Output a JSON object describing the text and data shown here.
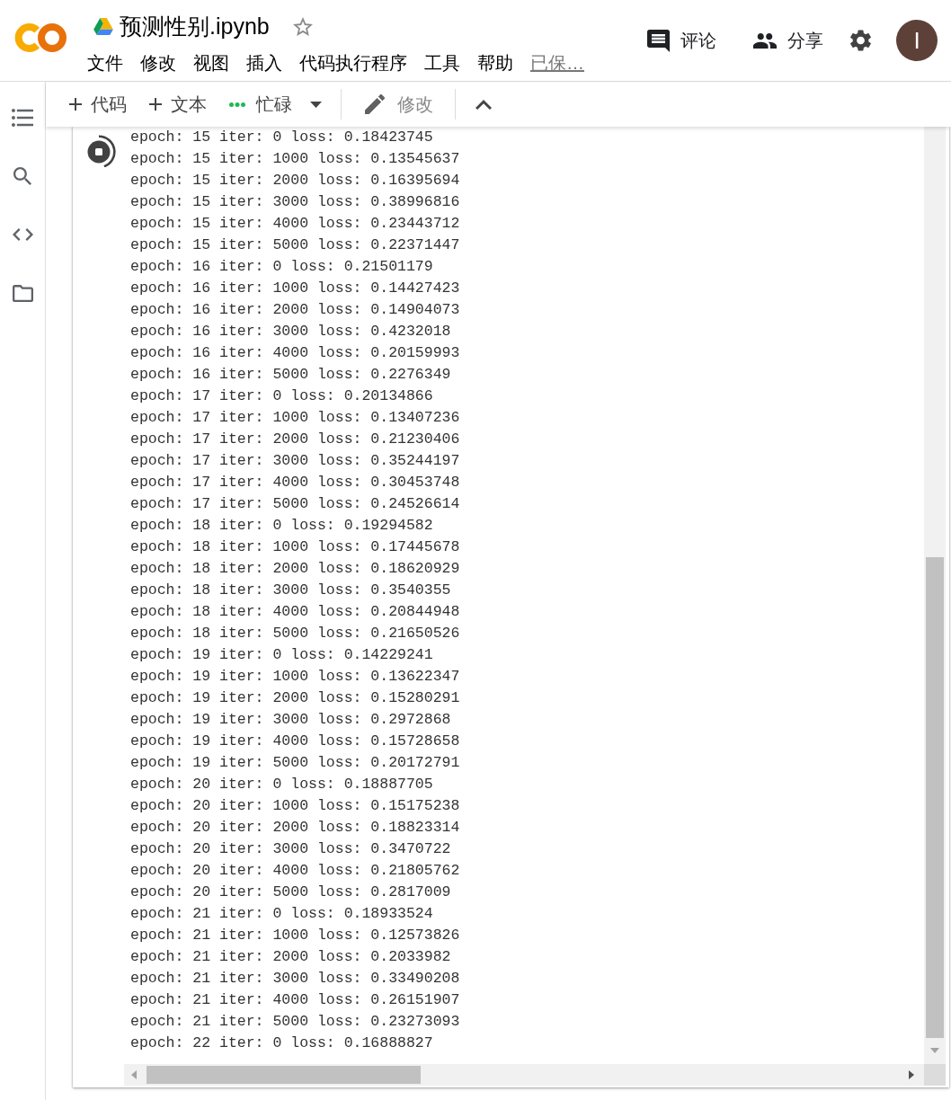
{
  "header": {
    "title": "预测性别.ipynb",
    "starred": false,
    "menu": [
      "文件",
      "修改",
      "视图",
      "插入",
      "代码执行程序",
      "工具",
      "帮助"
    ],
    "save_status": "已保…",
    "actions": [
      {
        "kind": "comment",
        "label": "评论"
      },
      {
        "kind": "share",
        "label": "分享"
      }
    ],
    "avatar": "I"
  },
  "toolbar": {
    "add_buttons": [
      "代码",
      "文本"
    ],
    "runtime_status": "忙碌",
    "edit_label": "修改"
  },
  "cell": {
    "running": true,
    "output": [
      "epoch: 15 iter: 0 loss: 0.18423745",
      "epoch: 15 iter: 1000 loss: 0.13545637",
      "epoch: 15 iter: 2000 loss: 0.16395694",
      "epoch: 15 iter: 3000 loss: 0.38996816",
      "epoch: 15 iter: 4000 loss: 0.23443712",
      "epoch: 15 iter: 5000 loss: 0.22371447",
      "epoch: 16 iter: 0 loss: 0.21501179",
      "epoch: 16 iter: 1000 loss: 0.14427423",
      "epoch: 16 iter: 2000 loss: 0.14904073",
      "epoch: 16 iter: 3000 loss: 0.4232018",
      "epoch: 16 iter: 4000 loss: 0.20159993",
      "epoch: 16 iter: 5000 loss: 0.2276349",
      "epoch: 17 iter: 0 loss: 0.20134866",
      "epoch: 17 iter: 1000 loss: 0.13407236",
      "epoch: 17 iter: 2000 loss: 0.21230406",
      "epoch: 17 iter: 3000 loss: 0.35244197",
      "epoch: 17 iter: 4000 loss: 0.30453748",
      "epoch: 17 iter: 5000 loss: 0.24526614",
      "epoch: 18 iter: 0 loss: 0.19294582",
      "epoch: 18 iter: 1000 loss: 0.17445678",
      "epoch: 18 iter: 2000 loss: 0.18620929",
      "epoch: 18 iter: 3000 loss: 0.3540355",
      "epoch: 18 iter: 4000 loss: 0.20844948",
      "epoch: 18 iter: 5000 loss: 0.21650526",
      "epoch: 19 iter: 0 loss: 0.14229241",
      "epoch: 19 iter: 1000 loss: 0.13622347",
      "epoch: 19 iter: 2000 loss: 0.15280291",
      "epoch: 19 iter: 3000 loss: 0.2972868",
      "epoch: 19 iter: 4000 loss: 0.15728658",
      "epoch: 19 iter: 5000 loss: 0.20172791",
      "epoch: 20 iter: 0 loss: 0.18887705",
      "epoch: 20 iter: 1000 loss: 0.15175238",
      "epoch: 20 iter: 2000 loss: 0.18823314",
      "epoch: 20 iter: 3000 loss: 0.3470722",
      "epoch: 20 iter: 4000 loss: 0.21805762",
      "epoch: 20 iter: 5000 loss: 0.2817009",
      "epoch: 21 iter: 0 loss: 0.18933524",
      "epoch: 21 iter: 1000 loss: 0.12573826",
      "epoch: 21 iter: 2000 loss: 0.2033982",
      "epoch: 21 iter: 3000 loss: 0.33490208",
      "epoch: 21 iter: 4000 loss: 0.26151907",
      "epoch: 21 iter: 5000 loss: 0.23273093",
      "epoch: 22 iter: 0 loss: 0.16888827"
    ]
  }
}
